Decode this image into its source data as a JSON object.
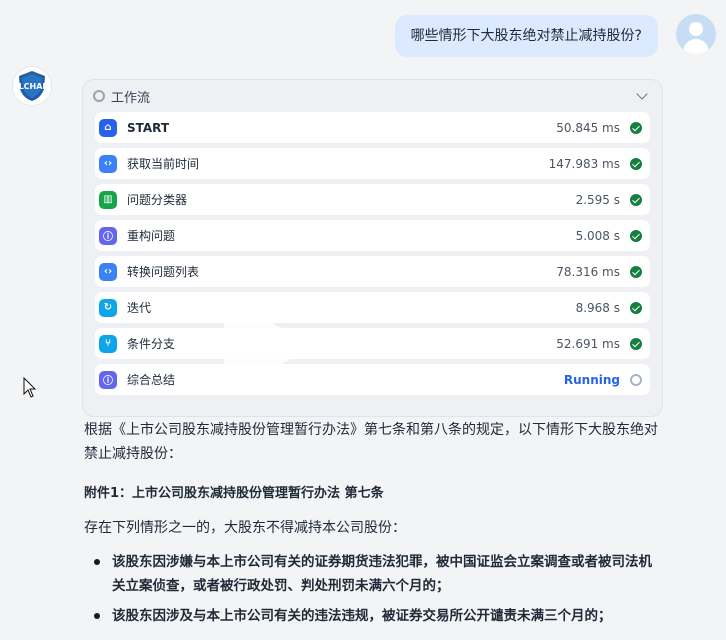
{
  "user": {
    "question": "哪些情形下大股东绝对禁止减持股份?"
  },
  "bot": {
    "logo_text": "LCHAI"
  },
  "workflow": {
    "title": "工作流",
    "steps": [
      {
        "name": "START",
        "time": "50.845 ms",
        "status": "done",
        "icon": "home-icon",
        "color": "#2563eb"
      },
      {
        "name": "获取当前时间",
        "time": "147.983 ms",
        "status": "done",
        "icon": "code-icon",
        "color": "#3b82f6"
      },
      {
        "name": "问题分类器",
        "time": "2.595 s",
        "status": "done",
        "icon": "classifier-icon",
        "color": "#16a34a"
      },
      {
        "name": "重构问题",
        "time": "5.008 s",
        "status": "done",
        "icon": "info-icon",
        "color": "#6366f1"
      },
      {
        "name": "转换问题列表",
        "time": "78.316 ms",
        "status": "done",
        "icon": "code-icon",
        "color": "#3b82f6"
      },
      {
        "name": "迭代",
        "time": "8.968 s",
        "status": "done",
        "icon": "loop-icon",
        "color": "#0ea5e9"
      },
      {
        "name": "条件分支",
        "time": "52.691 ms",
        "status": "done",
        "icon": "branch-icon",
        "color": "#0ea5e9"
      },
      {
        "name": "综合总结",
        "time": "Running",
        "status": "running",
        "icon": "info-icon",
        "color": "#6366f1"
      }
    ]
  },
  "answer": {
    "intro": "根据《上市公司股东减持股份管理暂行办法》第七条和第八条的规定，以下情形下大股东绝对禁止减持股份：",
    "heading": "附件1：上市公司股东减持股份管理暂行办法 第七条",
    "lead": "存在下列情形之一的，大股东不得减持本公司股份：",
    "bullets": [
      "该股东因涉嫌与本上市公司有关的证券期货违法犯罪，被中国证监会立案调查或者被司法机关立案侦查，或者被行政处罚、判处刑罚未满六个月的；",
      "该股东因涉及与本上市公司有关的违法违规，被证券交易所公开谴责未满三个月的；"
    ]
  }
}
